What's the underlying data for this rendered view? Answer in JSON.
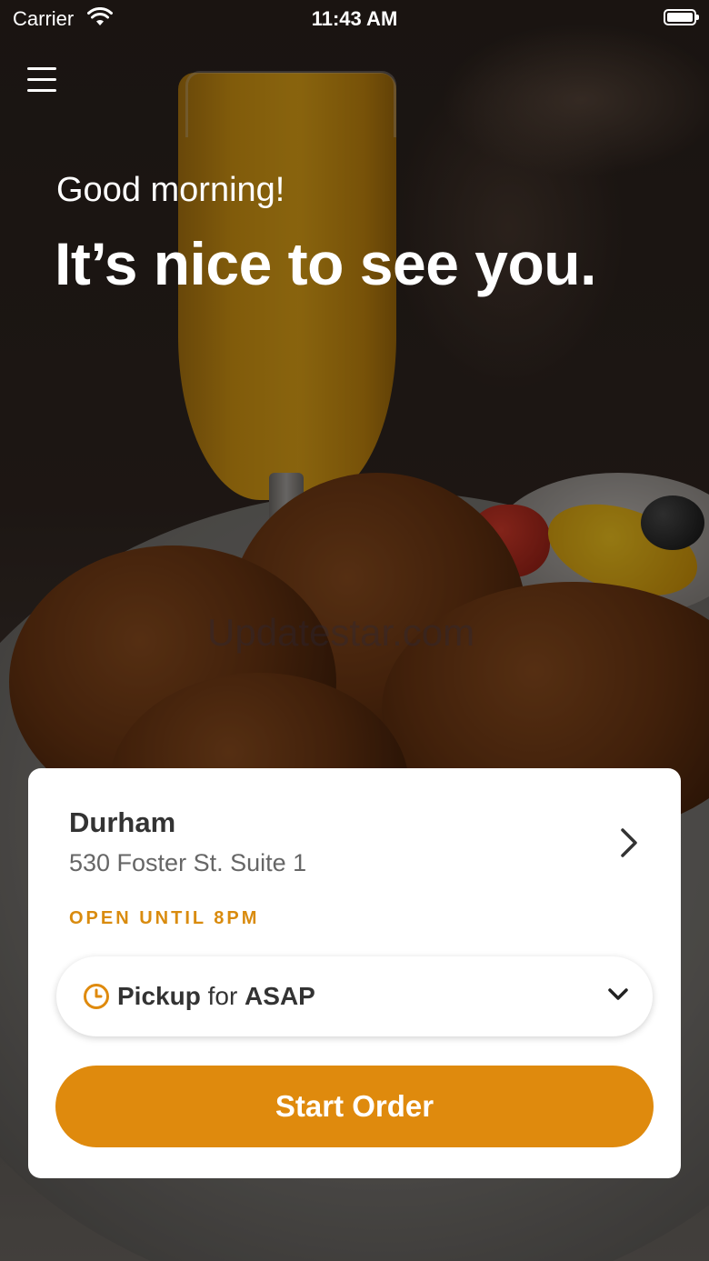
{
  "status_bar": {
    "carrier": "Carrier",
    "time": "11:43 AM"
  },
  "hero": {
    "greeting": "Good morning!",
    "headline": "It’s nice to see you.",
    "watermark": "Updatestar.com"
  },
  "location": {
    "name": "Durham",
    "address": "530 Foster St. Suite 1",
    "hours": "OPEN UNTIL 8PM"
  },
  "order_mode": {
    "mode": "Pickup",
    "connector": " for ",
    "time": "ASAP"
  },
  "actions": {
    "start_order": "Start Order"
  },
  "colors": {
    "accent": "#df8a0d",
    "hours_text": "#d98b0e"
  },
  "icons": [
    "wifi-icon",
    "battery-icon",
    "hamburger-menu-icon",
    "chevron-right-icon",
    "clock-icon",
    "chevron-down-icon"
  ]
}
